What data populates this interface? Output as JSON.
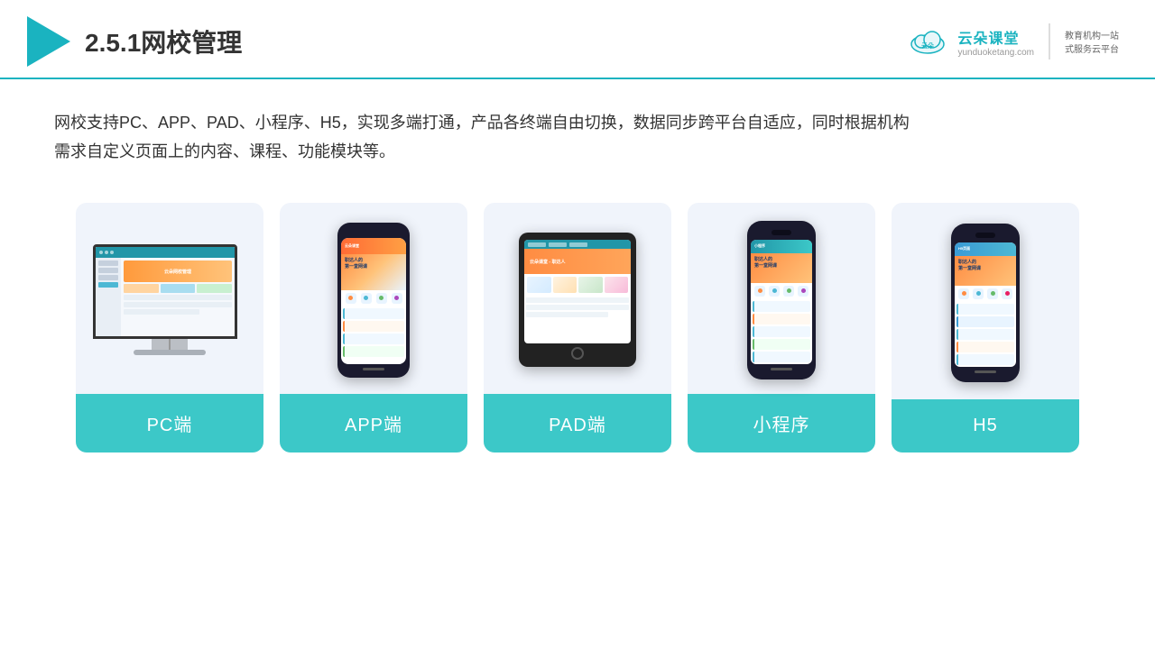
{
  "header": {
    "section_number": "2.5.1",
    "title": "网校管理",
    "brand_name": "云朵课堂",
    "brand_sub": "教育机构一站\n式服务云平台",
    "brand_url": "yunduoketang.com"
  },
  "description": {
    "text": "网校支持PC、APP、PAD、小程序、H5，实现多端打通，产品各终端自由切换，数据同步跨平台自适应，同时根据机构需求自定义页面上的内容、课程、功能模块等。"
  },
  "cards": [
    {
      "id": "pc",
      "label": "PC端"
    },
    {
      "id": "app",
      "label": "APP端"
    },
    {
      "id": "pad",
      "label": "PAD端"
    },
    {
      "id": "miniapp",
      "label": "小程序"
    },
    {
      "id": "h5",
      "label": "H5"
    }
  ],
  "colors": {
    "teal": "#3cc8c8",
    "header_line": "#1ab3c0"
  }
}
